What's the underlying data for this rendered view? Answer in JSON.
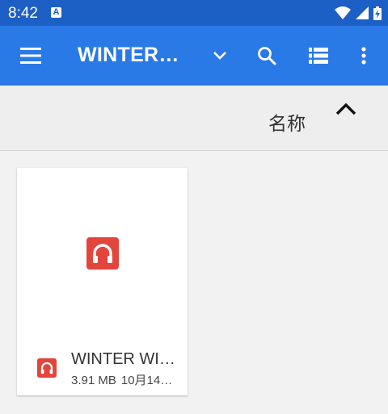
{
  "status_bar": {
    "time": "8:42",
    "notification_letter": "A",
    "icons": [
      "wifi-icon",
      "signal-icon",
      "battery-charging-icon"
    ]
  },
  "toolbar": {
    "menu_icon": "hamburger-menu-icon",
    "title": "WINTER…",
    "dropdown_icon": "chevron-down-icon",
    "search_icon": "search-icon",
    "view_icon": "list-view-icon",
    "more_icon": "more-vert-icon",
    "background_color": "#2979e6"
  },
  "sort": {
    "label": "名称",
    "direction_icon": "chevron-up-icon"
  },
  "files": [
    {
      "icon": "headphones-audio-icon",
      "icon_color": "#e2453c",
      "name": "WINTER WI…",
      "size": "3.91 MB",
      "date": "10月14…"
    }
  ]
}
